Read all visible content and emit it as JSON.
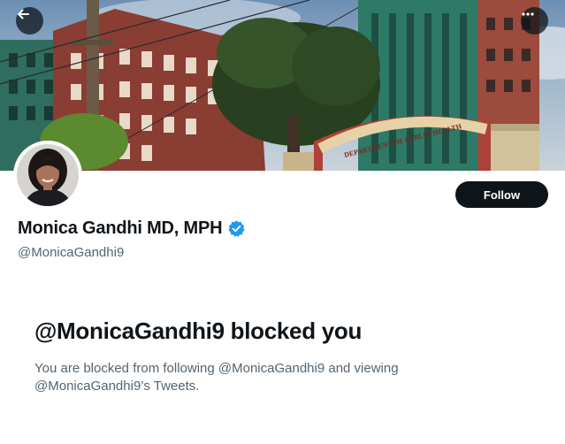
{
  "header": {
    "back_icon": "arrow-left-icon",
    "more_icon": "more-horizontal-icon",
    "banner_sign": "DEPARTMENT OF PUBLIC HEALTH"
  },
  "profile": {
    "display_name": "Monica Gandhi MD, MPH",
    "handle": "@MonicaGandhi9",
    "verified_icon": "verified-badge-icon",
    "follow_label": "Follow"
  },
  "blocked": {
    "title": "@MonicaGandhi9 blocked you",
    "body_line_1": "You are blocked from following @MonicaGandhi9 and viewing",
    "body_line_2": "@MonicaGandhi9’s Tweets."
  },
  "colors": {
    "follow_bg": "#0f1419",
    "verified": "#1d9bf0",
    "secondary_text": "#536471",
    "banner_arch": "#b0413a"
  }
}
